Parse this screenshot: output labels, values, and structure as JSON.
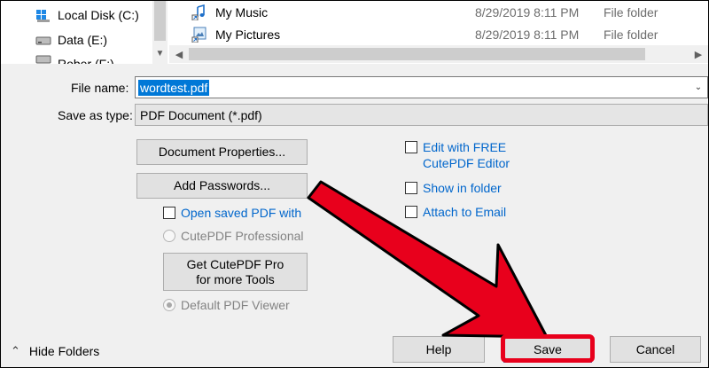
{
  "tree": {
    "items": [
      {
        "label": "Local Disk (C:)",
        "icon": "drive-icon"
      },
      {
        "label": "Data (E:)",
        "icon": "drive-icon"
      },
      {
        "label": "Rober (F:)",
        "icon": "drive-icon"
      }
    ]
  },
  "files": [
    {
      "name": "My Music",
      "date": "8/29/2019 8:11 PM",
      "type": "File folder",
      "icon": "music-shortcut-icon"
    },
    {
      "name": "My Pictures",
      "date": "8/29/2019 8:11 PM",
      "type": "File folder",
      "icon": "pictures-shortcut-icon"
    }
  ],
  "form": {
    "file_name_label": "File name:",
    "file_name_value": "wordtest.pdf",
    "save_as_type_label": "Save as type:",
    "save_as_type_value": "PDF Document (*.pdf)"
  },
  "options": {
    "document_properties": "Document Properties...",
    "add_passwords": "Add Passwords...",
    "open_saved_pdf_with": "Open saved PDF with",
    "cutepdf_professional": "CutePDF Professional",
    "get_cutepdf_pro_line1": "Get CutePDF Pro",
    "get_cutepdf_pro_line2": "for more Tools",
    "default_pdf_viewer": "Default PDF Viewer",
    "edit_with_free_line1": "Edit with FREE",
    "edit_with_free_line2": "CutePDF Editor",
    "show_in_folder": "Show in folder",
    "attach_to_email": "Attach to Email"
  },
  "footer": {
    "hide_folders": "Hide Folders",
    "help": "Help",
    "save": "Save",
    "cancel": "Cancel"
  },
  "colors": {
    "annotation_red": "#e8001c",
    "selection_blue": "#0078d7",
    "link_blue": "#0066cc"
  }
}
